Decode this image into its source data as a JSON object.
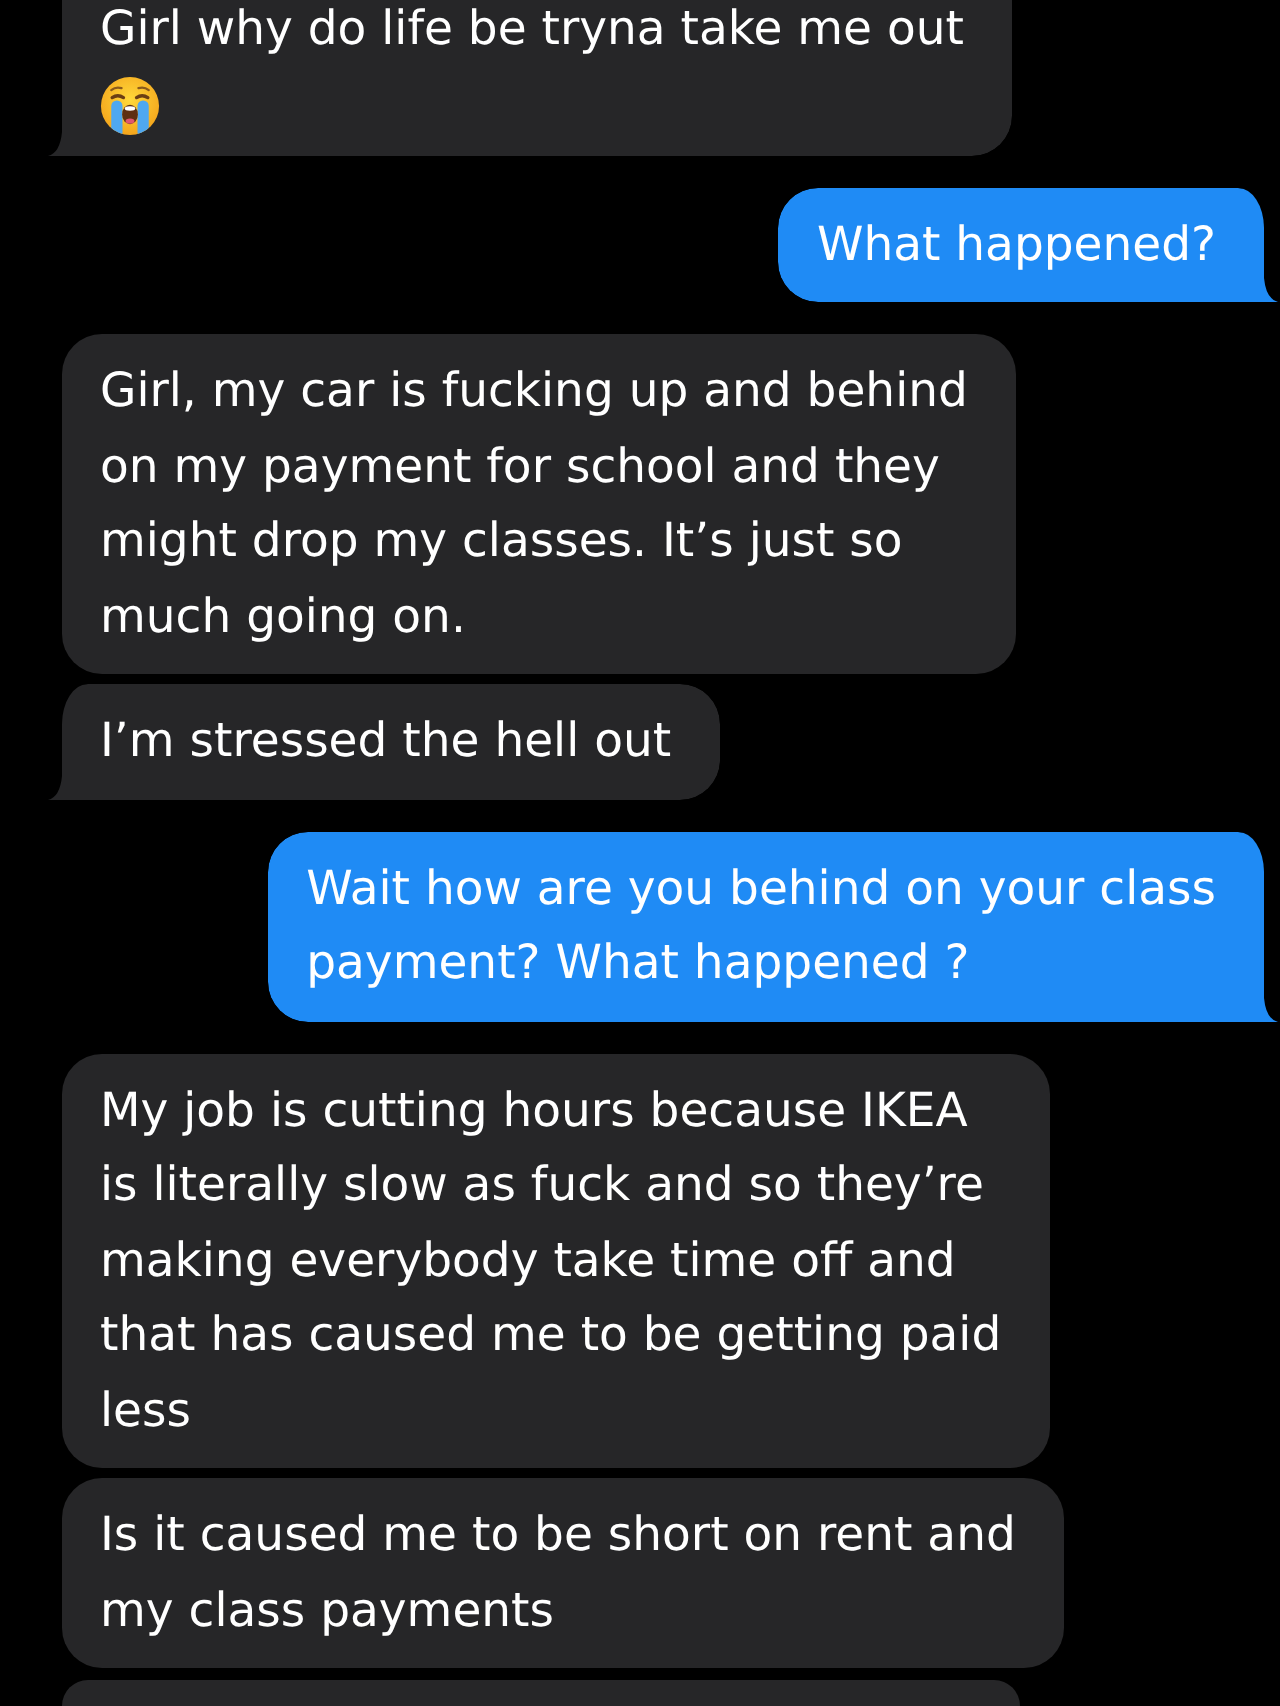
{
  "messages": [
    {
      "kind": "received",
      "text": "Girl why do life be tryna take me out",
      "emoji": true,
      "tail": true,
      "cut_off_top": true,
      "cut_off_bottom": false
    },
    {
      "kind": "sent",
      "text": "What happened?",
      "emoji": false,
      "tail": true,
      "cut_off_top": false,
      "cut_off_bottom": false
    },
    {
      "kind": "received",
      "text": "Girl, my car is fucking up and behind\non my payment for school and they\nmight drop my classes. It’s just so\nmuch going on.",
      "emoji": false,
      "tail": false,
      "cut_off_top": false,
      "cut_off_bottom": false
    },
    {
      "kind": "received",
      "text": "I’m stressed the hell out",
      "emoji": false,
      "tail": true,
      "cut_off_top": false,
      "cut_off_bottom": false
    },
    {
      "kind": "sent",
      "text": "Wait how are you behind on your class\npayment? What happened ?",
      "emoji": false,
      "tail": true,
      "cut_off_top": false,
      "cut_off_bottom": false
    },
    {
      "kind": "received",
      "text": "My job is cutting hours because IKEA\nis literally slow as fuck and so they’re\nmaking everybody take time off and\nthat has caused me to be getting paid\nless",
      "emoji": false,
      "tail": false,
      "cut_off_top": false,
      "cut_off_bottom": false
    },
    {
      "kind": "received",
      "text": "Is it caused me to be short on rent and\nmy class payments",
      "emoji": false,
      "tail": false,
      "cut_off_top": false,
      "cut_off_bottom": false
    },
    {
      "kind": "received",
      "emoji": false,
      "tail": false,
      "cut_off_top": false,
      "cut_off_bottom": true
    }
  ]
}
